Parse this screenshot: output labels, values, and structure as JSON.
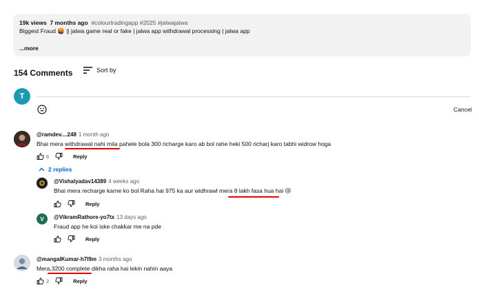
{
  "description": {
    "views": "19k views",
    "age": "7 months ago",
    "tags": "#colourtradingapp #2025 #jalwajalwa",
    "title": "Biggest Fraud 🤬 || jalwa game real or fake | jalwa app withdrawal processing | jalwa app",
    "more": "...more"
  },
  "comments_header": {
    "count": "154 Comments",
    "sort_label": "Sort by"
  },
  "add_comment": {
    "avatar_letter": "T",
    "cancel": "Cancel"
  },
  "comments": [
    {
      "author": "@ramdev....248",
      "time": "1 month ago",
      "text": "Bhai mera withdrawal nahi mila  pahele bola 300 richarge karo ab bol rahe heki 500 richarj karo tabhi widrow hoga",
      "likes": "6",
      "reply_label": "Reply"
    },
    {
      "author": "@mangalKumar-h7l9m",
      "time": "3 months ago",
      "text": "Mera,3200 complete dikha raha hai lekin nahin aaya",
      "likes": "2",
      "reply_label": "Reply"
    }
  ],
  "replies_toggle": "2 replies",
  "replies": [
    {
      "author": "@Vishalyadav14389",
      "time": "4 weeks ago",
      "text": "Bhai mera recharge karne ko bol Raha hai 975 ka aur widhrawl mera 8 lakh fasa hua hai 😢",
      "reply_label": "Reply"
    },
    {
      "author": "@VikramRathore-yo7tx",
      "time": "13 days ago",
      "avatar_letter": "V",
      "text": "Fraud app he koi iske chakkar me na pde",
      "reply_label": "Reply"
    }
  ],
  "colors": {
    "accent": "#065fd4",
    "avatar_t": "#1e9ab0",
    "avatar_v": "#1f6e52",
    "annotation": "#e00000"
  }
}
